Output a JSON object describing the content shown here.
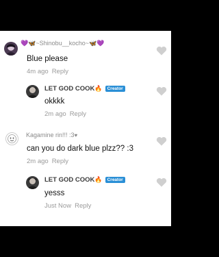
{
  "comments": [
    {
      "username": "💜🦋~Shinobu__kocho~🦋💜",
      "text": "Blue please",
      "time": "4m ago",
      "reply": "Reply"
    },
    {
      "username": "LET GOD COOK",
      "badge": "Creator",
      "text": "okkkk",
      "time": "2m ago",
      "reply": "Reply"
    },
    {
      "username": "Kagamine rin!!!  :3",
      "text": "can you do dark blue plzz?? :3",
      "time": "2m ago",
      "reply": "Reply"
    },
    {
      "username": "LET GOD COOK",
      "badge": "Creator",
      "text": "yesss",
      "time": "Just Now",
      "reply": "Reply"
    }
  ],
  "icons": {
    "like": "heart-outline-icon",
    "fire": "fire-icon"
  },
  "colors": {
    "badge": "#2a8fd6",
    "like": "#cfcfcf"
  }
}
